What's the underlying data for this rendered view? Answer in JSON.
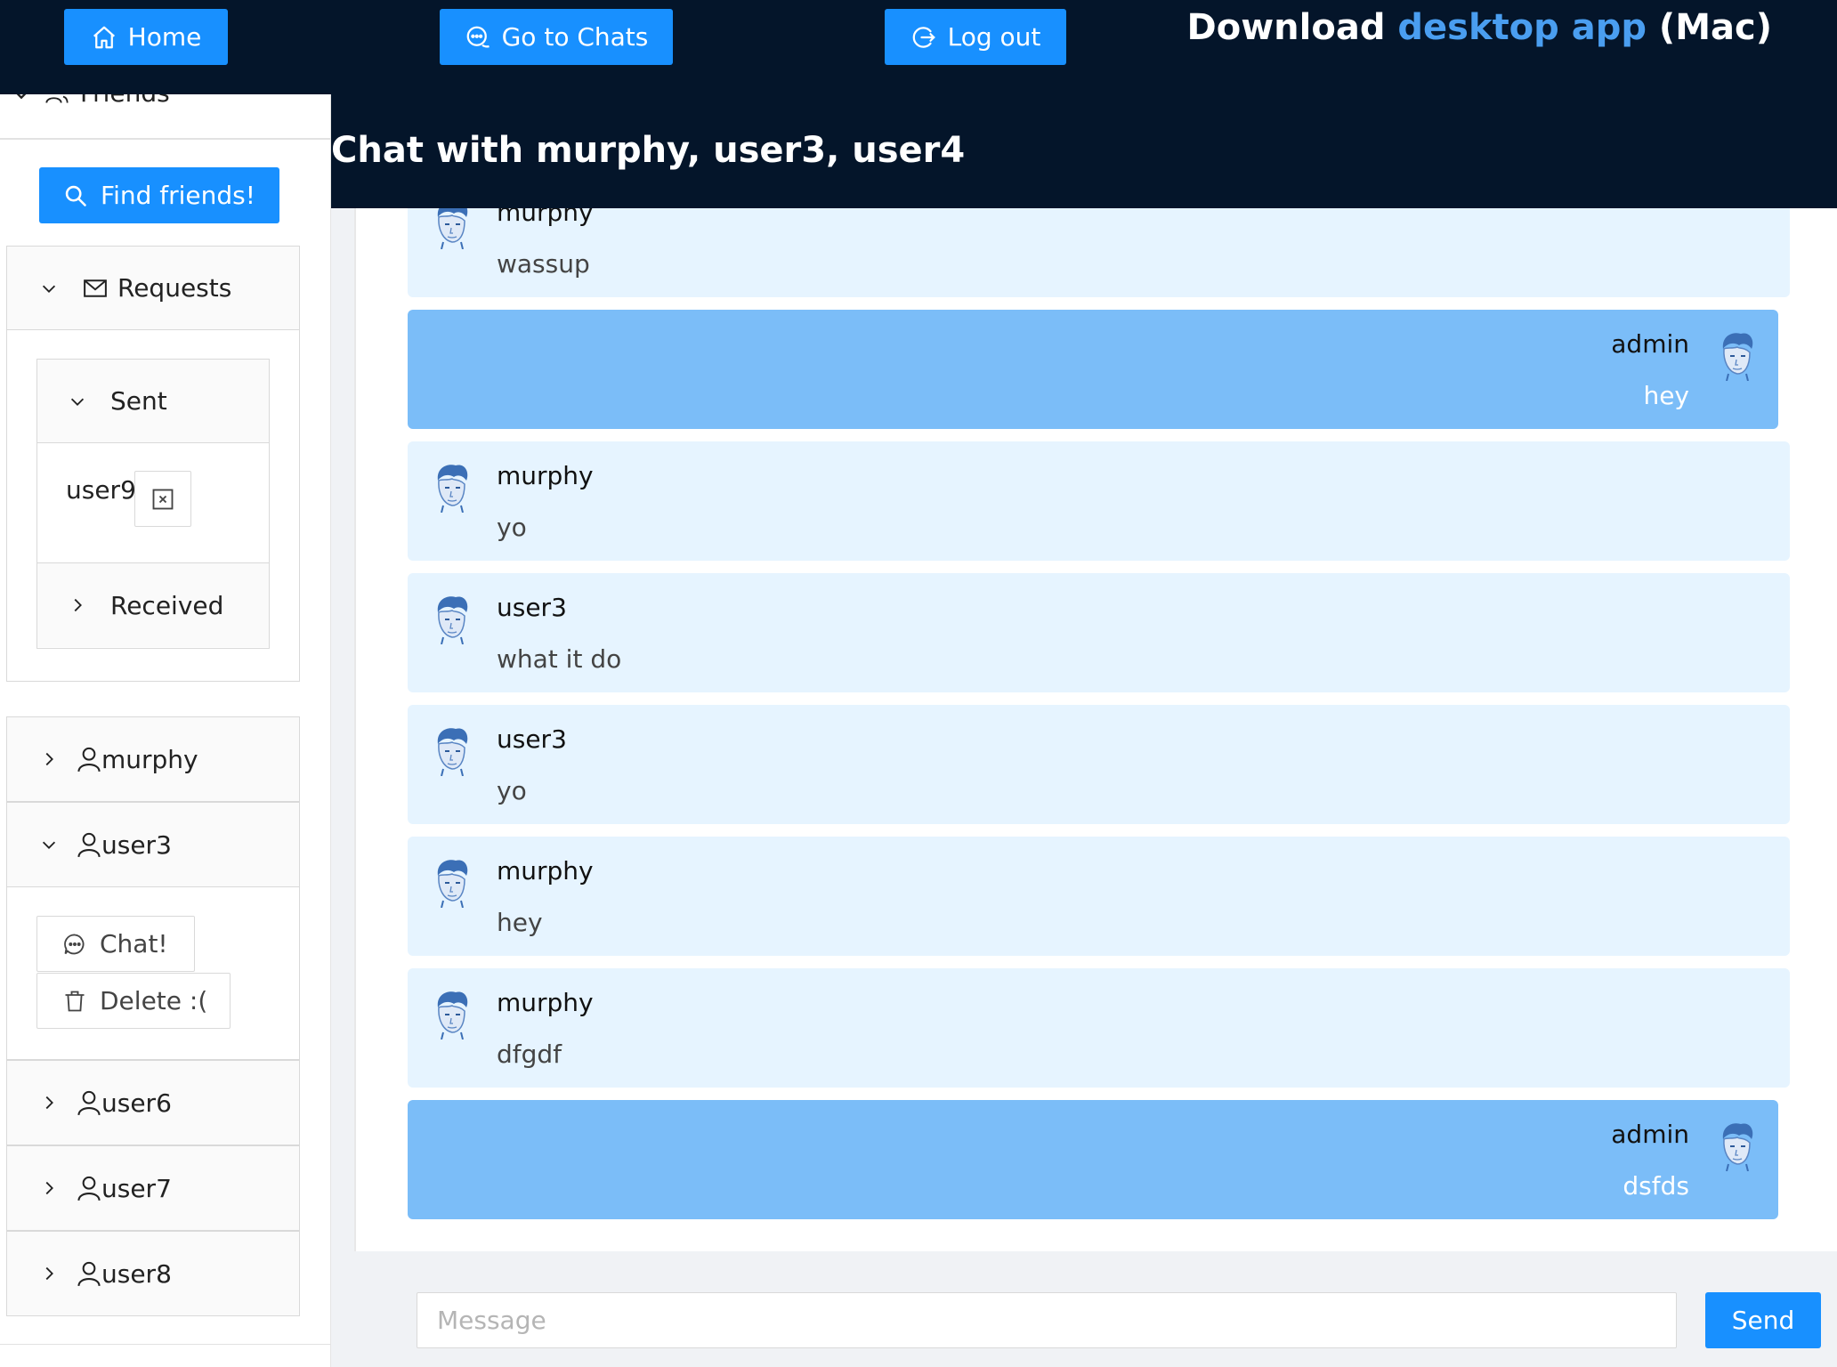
{
  "header": {
    "home_label": "Home",
    "chats_label": "Go to Chats",
    "logout_label": "Log out",
    "download_prefix": "Download",
    "download_link": "desktop app",
    "download_suffix": "(Mac)"
  },
  "sidebar": {
    "friends_label": "Friends",
    "find_friends_label": "Find friends!",
    "requests": {
      "title": "Requests",
      "sent_title": "Sent",
      "sent_users": [
        "user9"
      ],
      "received_title": "Received"
    },
    "friends": [
      {
        "name": "murphy"
      },
      {
        "name": "user3"
      },
      {
        "name": "user6"
      },
      {
        "name": "user7"
      },
      {
        "name": "user8"
      }
    ],
    "chat_button_label": "Chat!",
    "delete_button_label": "Delete :("
  },
  "chat": {
    "title": "Chat with murphy, user3, user4",
    "messages": [
      {
        "sender": "murphy",
        "text": "wassup",
        "self": false
      },
      {
        "sender": "admin",
        "text": "hey",
        "self": true
      },
      {
        "sender": "murphy",
        "text": "yo",
        "self": false
      },
      {
        "sender": "user3",
        "text": "what it do",
        "self": false
      },
      {
        "sender": "user3",
        "text": "yo",
        "self": false
      },
      {
        "sender": "murphy",
        "text": "hey",
        "self": false
      },
      {
        "sender": "murphy",
        "text": "dfgdf",
        "self": false
      },
      {
        "sender": "admin",
        "text": "dsfds",
        "self": true
      }
    ]
  },
  "composer": {
    "placeholder": "Message",
    "value": "",
    "send_label": "Send"
  },
  "colors": {
    "header_bg": "#04152a",
    "primary": "#1890ff",
    "link": "#4a9ef0",
    "other_bubble": "#e6f4ff",
    "self_bubble": "#7bbdf8"
  },
  "icons": {
    "home": "home-icon",
    "chats": "chat-bubbles-icon",
    "logout": "logout-icon",
    "friends": "team-icon",
    "search": "search-icon",
    "requests": "mail-icon",
    "remove": "close-square-icon",
    "friend": "user-icon",
    "chat": "message-icon",
    "delete": "delete-icon"
  }
}
